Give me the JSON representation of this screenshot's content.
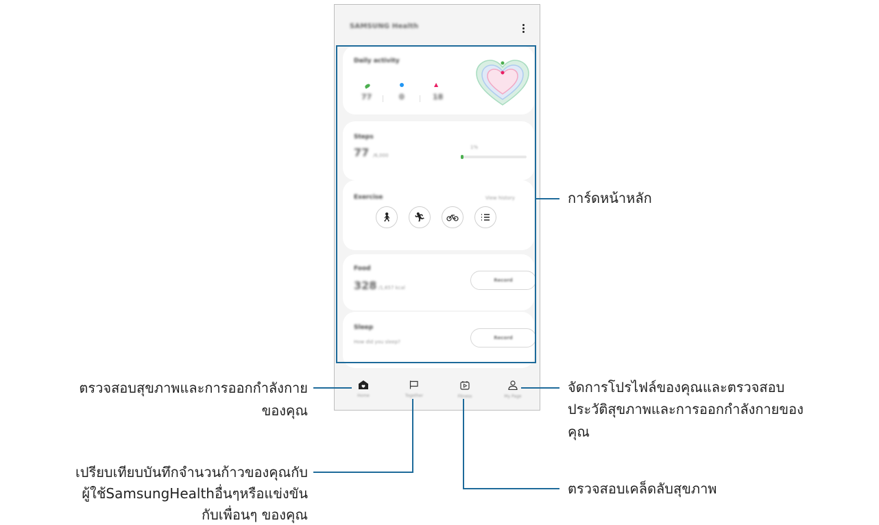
{
  "app": {
    "title": "SAMSUNG Health",
    "more_icon": "more-vertical-icon"
  },
  "daily_activity": {
    "label": "Daily activity",
    "steps_value": "77",
    "active_minutes_value": "0",
    "calories_value": "18"
  },
  "steps_card": {
    "label": "Steps",
    "value": "77",
    "goal": "/6,000",
    "progress_label": "1%",
    "progress_fraction": 0.01
  },
  "exercise_card": {
    "label": "Exercise",
    "history_link": "View history",
    "buttons": [
      "walk-icon",
      "run-icon",
      "bike-icon",
      "list-icon"
    ]
  },
  "food_card": {
    "label": "Food",
    "value": "328",
    "unit": "/1,657 kcal",
    "record_label": "Record"
  },
  "sleep_card": {
    "label": "Sleep",
    "prompt": "How did you sleep?",
    "record_label": "Record"
  },
  "nav": {
    "home": "Home",
    "together": "Together",
    "fitness": "Fitness",
    "my_page": "My Page"
  },
  "callouts": {
    "home_cards": "การ์ดหน้าหลัก",
    "home_tab_line1": "ตรวจสอบสุขภาพและการออกกำลังกาย",
    "home_tab_line2": "ของคุณ",
    "together_line1": "เปรียบเทียบบันทึกจำนวนก้าวของคุณกับ",
    "together_line2": "ผู้ใช้SamsungHealthอื่นๆหรือแข่งขัน",
    "together_line3": "กับเพื่อนๆ ของคุณ",
    "fitness": "ตรวจสอบเคล็ดลับสุขภาพ",
    "mypage_line1": "จัดการโปรไฟล์ของคุณและตรวจสอบ",
    "mypage_line2": "ประวัติสุขภาพและการออกกำลังกายของ",
    "mypage_line3": "คุณ"
  },
  "colors": {
    "callout_line": "#1d6a9a",
    "steps_green": "#4caf50",
    "active_blue": "#2196f3",
    "calorie_pink": "#e91e63"
  }
}
